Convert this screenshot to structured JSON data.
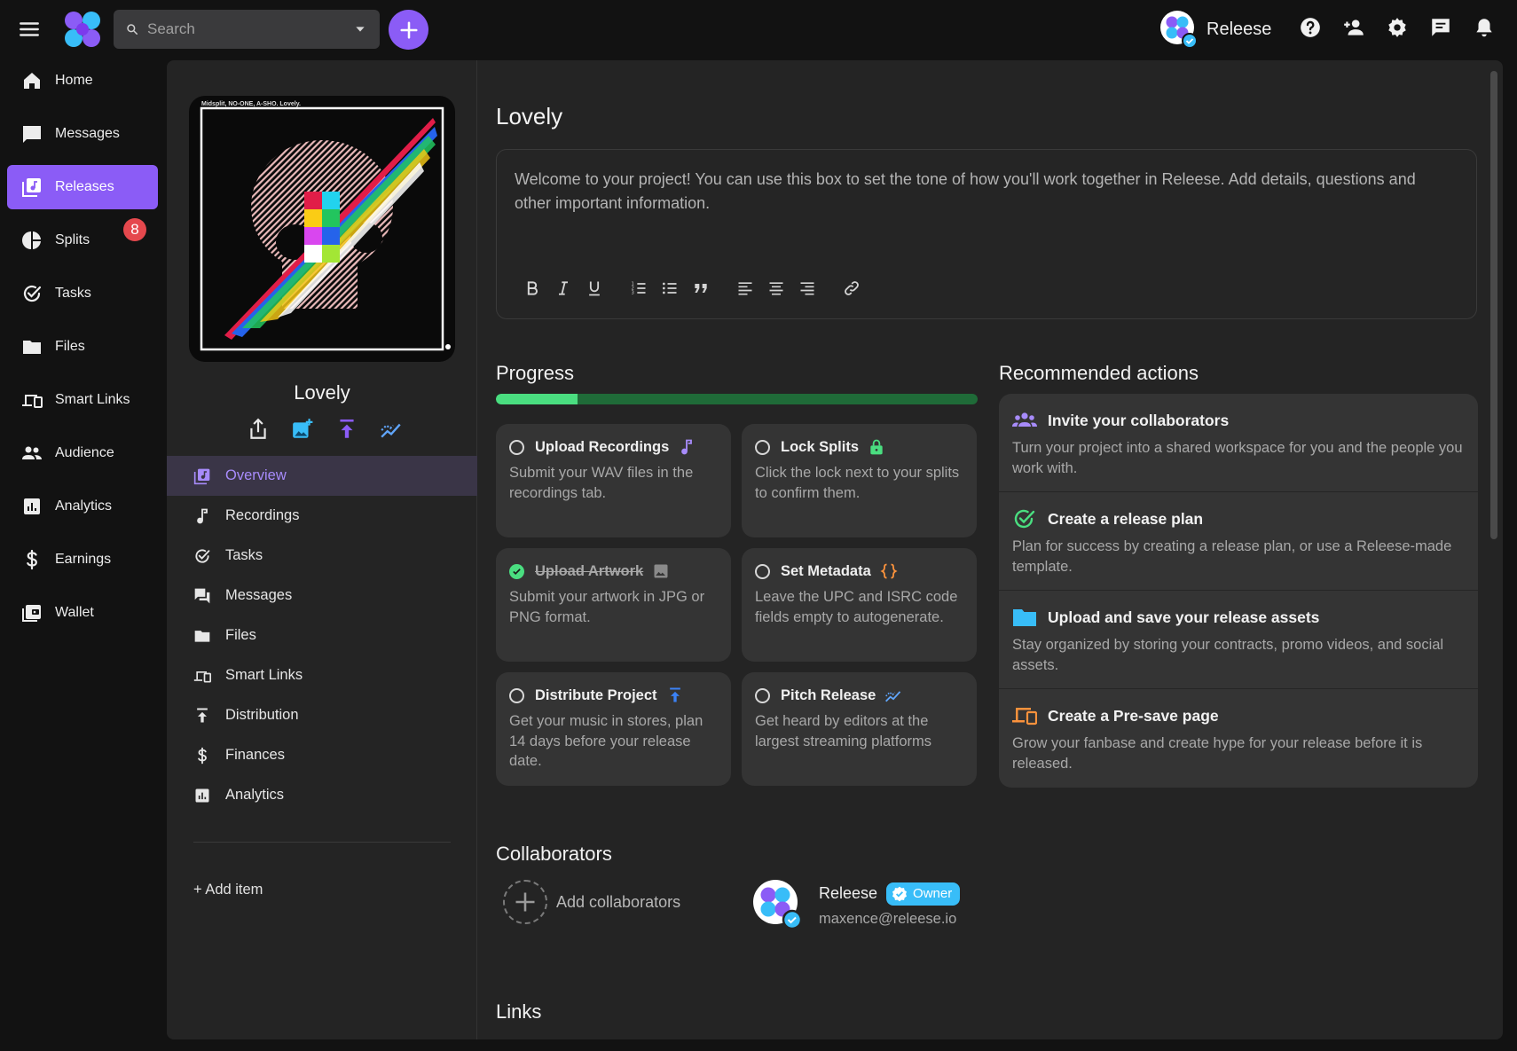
{
  "topbar": {
    "search_placeholder": "Search",
    "account_name": "Releese"
  },
  "nav": {
    "items": [
      {
        "label": "Home",
        "icon": "home-icon"
      },
      {
        "label": "Messages",
        "icon": "chat-icon"
      },
      {
        "label": "Releases",
        "icon": "releases-icon",
        "active": true
      },
      {
        "label": "Splits",
        "icon": "pie-chart-icon",
        "badge": "8"
      },
      {
        "label": "Tasks",
        "icon": "check-circle-icon"
      },
      {
        "label": "Files",
        "icon": "folder-icon"
      },
      {
        "label": "Smart Links",
        "icon": "devices-icon"
      },
      {
        "label": "Audience",
        "icon": "people-icon"
      },
      {
        "label": "Analytics",
        "icon": "analytics-icon"
      },
      {
        "label": "Earnings",
        "icon": "dollar-icon"
      },
      {
        "label": "Wallet",
        "icon": "wallet-icon"
      }
    ]
  },
  "release": {
    "artwork_caption": "Midsplit, NO-ONE, A-SHO. Lovely.",
    "title": "Lovely",
    "subnav": [
      {
        "label": "Overview",
        "icon": "releases-icon",
        "active": true
      },
      {
        "label": "Recordings",
        "icon": "music-note-icon"
      },
      {
        "label": "Tasks",
        "icon": "check-circle-icon"
      },
      {
        "label": "Messages",
        "icon": "forum-icon"
      },
      {
        "label": "Files",
        "icon": "folder-icon"
      },
      {
        "label": "Smart Links",
        "icon": "devices-icon"
      },
      {
        "label": "Distribution",
        "icon": "publish-icon"
      },
      {
        "label": "Finances",
        "icon": "dollar-icon"
      },
      {
        "label": "Analytics",
        "icon": "analytics-icon"
      }
    ],
    "add_item": "+ Add item"
  },
  "main": {
    "title": "Lovely",
    "editor_placeholder": "Welcome to your project! You can use this box to set the tone of how you'll work together in Releese. Add details, questions and other important information.",
    "progress": {
      "title": "Progress",
      "fraction": 0.17,
      "tasks": [
        {
          "title": "Upload Recordings",
          "desc": "Submit your WAV files in the recordings tab.",
          "done": false,
          "icon": "music-note-icon",
          "icon_color": "#a78bfa"
        },
        {
          "title": "Lock Splits",
          "desc": "Click the lock next to your splits to confirm them.",
          "done": false,
          "icon": "lock-icon",
          "icon_color": "#4ade80"
        },
        {
          "title": "Upload Artwork",
          "desc": "Submit your artwork in JPG or PNG format.",
          "done": true,
          "icon": "image-icon",
          "icon_color": "#8a8a8a"
        },
        {
          "title": "Set Metadata",
          "desc": "Leave the UPC and ISRC code fields empty to autogenerate.",
          "done": false,
          "icon": "braces-icon",
          "icon_color": "#fb923c"
        },
        {
          "title": "Distribute Project",
          "desc": "Get your music in stores, plan 14 days before your release date.",
          "done": false,
          "icon": "publish-icon",
          "icon_color": "#3b82f6"
        },
        {
          "title": "Pitch Release",
          "desc": "Get heard by editors at the largest streaming platforms",
          "done": false,
          "icon": "trending-icon",
          "icon_color": "#60a5fa"
        }
      ]
    },
    "recommended": {
      "title": "Recommended actions",
      "items": [
        {
          "title": "Invite your collaborators",
          "desc": "Turn your project into a shared workspace for you and the people you work with.",
          "icon": "people-icon",
          "icon_color": "#a78bfa"
        },
        {
          "title": "Create a release plan",
          "desc": "Plan for success by creating a release plan, or use a Releese-made template.",
          "icon": "check-circle-icon",
          "icon_color": "#4ade80"
        },
        {
          "title": "Upload and save your release assets",
          "desc": "Stay organized by storing your contracts, promo videos, and social assets.",
          "icon": "folder-icon",
          "icon_color": "#38bdf8"
        },
        {
          "title": "Create a Pre-save page",
          "desc": "Grow your fanbase and create hype for your release before it is released.",
          "icon": "devices-icon",
          "icon_color": "#fb923c"
        }
      ]
    },
    "collaborators": {
      "title": "Collaborators",
      "add_label": "Add collaborators",
      "user": {
        "name": "Releese",
        "role": "Owner",
        "email": "maxence@releese.io"
      }
    },
    "links": {
      "title": "Links"
    }
  }
}
